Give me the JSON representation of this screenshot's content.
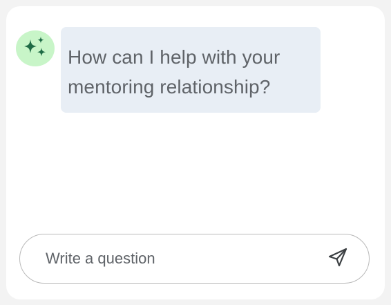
{
  "assistant": {
    "avatar_icon": "sparkles-icon",
    "avatar_bg": "#c8f5c8",
    "icon_color": "#1e6b45",
    "message": "How can I help with your mentoring relationship?"
  },
  "composer": {
    "placeholder": "Write a question",
    "value": "",
    "send_icon": "send-icon"
  }
}
